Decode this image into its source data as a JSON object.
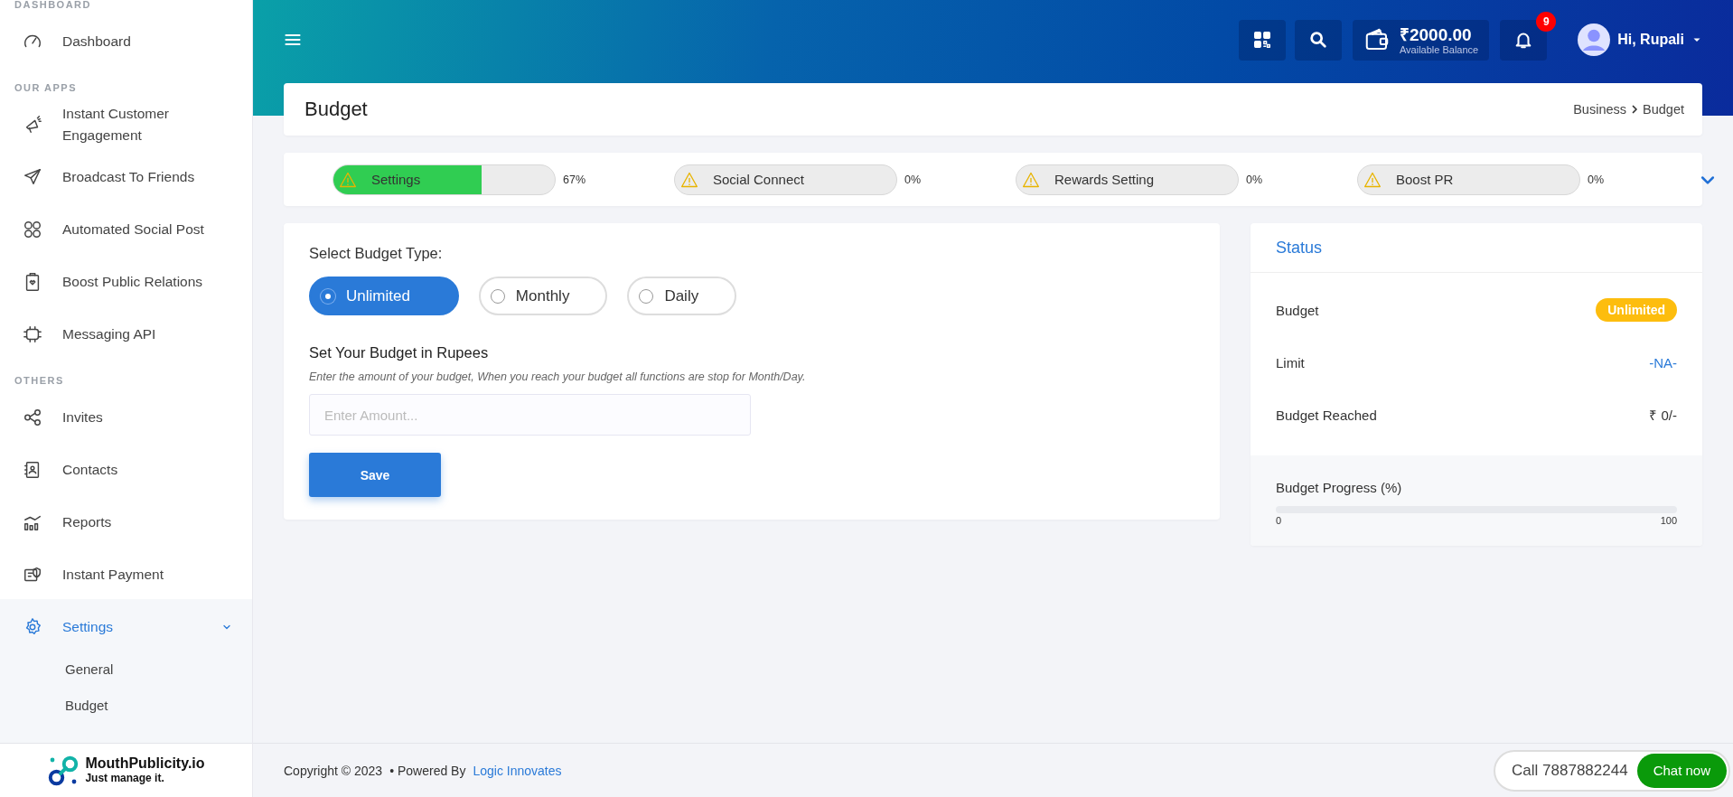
{
  "sidebar": {
    "sections": [
      {
        "heading": "DASHBOARD",
        "items": [
          {
            "label": "Dashboard",
            "selected": false
          }
        ]
      },
      {
        "heading": "OUR APPS",
        "items": [
          {
            "label": "Instant Customer Engagement",
            "selected": false
          },
          {
            "label": "Broadcast To Friends",
            "selected": false
          },
          {
            "label": "Automated Social Post",
            "selected": false
          },
          {
            "label": "Boost Public Relations",
            "selected": false
          },
          {
            "label": "Messaging API",
            "selected": false
          }
        ]
      },
      {
        "heading": "OTHERS",
        "items": [
          {
            "label": "Invites",
            "selected": false
          },
          {
            "label": "Contacts",
            "selected": false
          },
          {
            "label": "Reports",
            "selected": false
          },
          {
            "label": "Instant Payment",
            "selected": false
          },
          {
            "label": "Settings",
            "selected": true,
            "expanded": true,
            "children": [
              {
                "label": "General",
                "selected": false
              },
              {
                "label": "Budget",
                "selected": false
              }
            ]
          }
        ]
      }
    ],
    "logo": {
      "name": "MouthPublicity.io",
      "tagline": "Just manage it."
    }
  },
  "topbar": {
    "balance": {
      "amount": "₹2000.00",
      "caption": "Available Balance"
    },
    "notifications": {
      "count": "9"
    },
    "user": {
      "greeting": "Hi, Rupali"
    }
  },
  "page": {
    "title": "Budget",
    "breadcrumb": [
      "Business",
      "Budget"
    ]
  },
  "steps": [
    {
      "label": "Settings",
      "level": 0.67,
      "percent": "67%"
    },
    {
      "label": "Social Connect",
      "level": 0,
      "percent": "0%"
    },
    {
      "label": "Rewards Setting",
      "level": 0,
      "percent": "0%"
    },
    {
      "label": "Boost PR",
      "level": 0,
      "percent": "0%"
    }
  ],
  "form": {
    "heading": "Select Budget Type:",
    "options": [
      {
        "label": "Unlimited",
        "selected": true
      },
      {
        "label": "Monthly",
        "selected": false
      },
      {
        "label": "Daily",
        "selected": false
      }
    ],
    "amount_title": "Set Your Budget in Rupees",
    "hint": "Enter the amount of your budget, When you reach your budget all functions are stop for Month/Day.",
    "amount": {
      "placeholder": "Enter Amount..."
    },
    "save": "Save"
  },
  "status": {
    "title": "Status",
    "rows": [
      {
        "label": "Budget",
        "value": "Unlimited",
        "kind": "badge"
      },
      {
        "label": "Limit",
        "value": "-NA-",
        "kind": "accent"
      },
      {
        "label": "Budget Reached",
        "value": "₹ 0/-",
        "kind": "text"
      }
    ],
    "progress": {
      "label": "Budget Progress (%)",
      "level": 0,
      "min": "0",
      "max": "100"
    }
  },
  "footer": {
    "copyright": "Copyright © 2023",
    "powered": "• Powered By",
    "link": "Logic Innovates"
  },
  "chat": {
    "phone": "Call 7887882244",
    "button": "Chat now"
  }
}
